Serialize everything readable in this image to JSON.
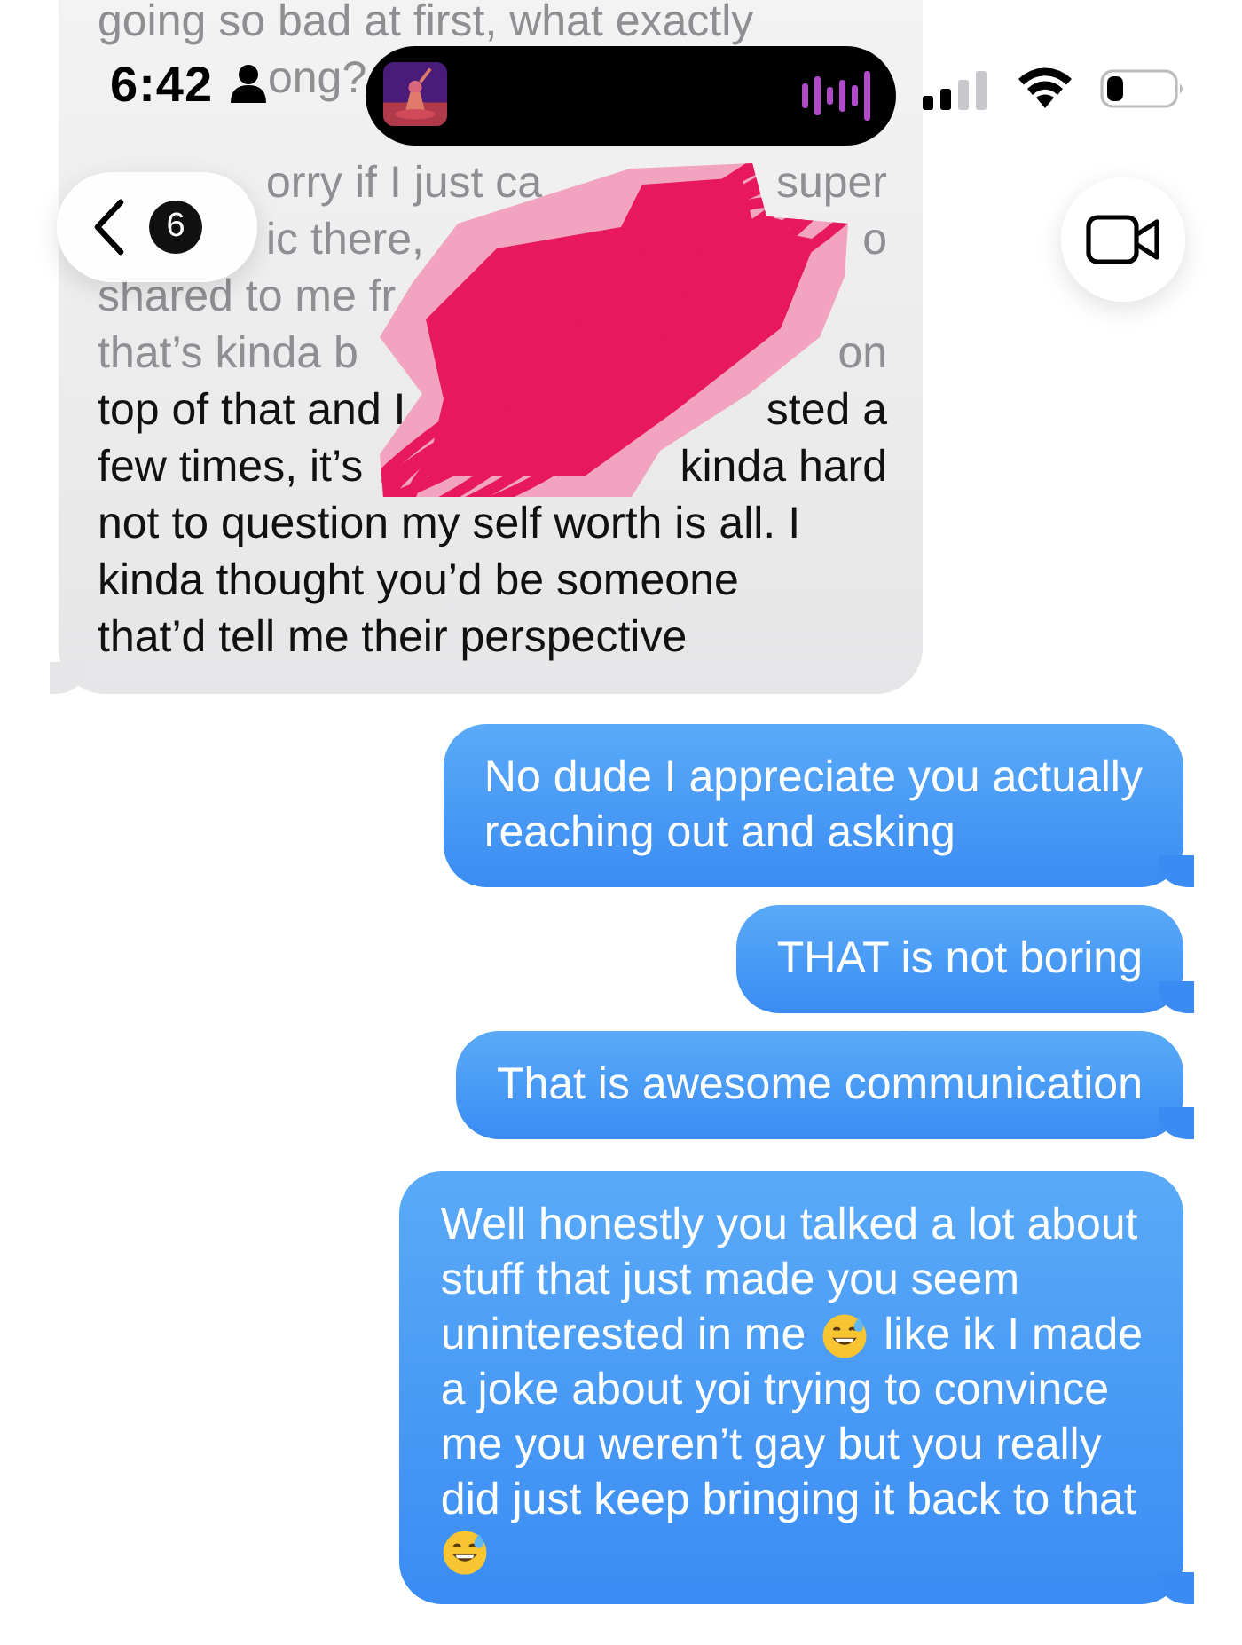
{
  "status_bar": {
    "time": "6:42"
  },
  "nav": {
    "back_count": "6"
  },
  "messages": [
    {
      "kind": "incoming",
      "lines": [
        [
          "going so bad at first, what exactly"
        ],
        [
          "ong?"
        ],
        [
          "orry if I just ca",
          "super"
        ],
        [
          "ic there,",
          "o"
        ],
        [
          "shared to me fr"
        ],
        [
          "that’s kinda b",
          "on"
        ],
        [
          "top of that and I",
          "sted a"
        ],
        [
          "few times, it’s",
          "kinda hard"
        ],
        [
          "not to question my self worth is all. I"
        ],
        [
          "kinda thought you’d be someone"
        ],
        [
          "that’d tell me their perspective"
        ]
      ]
    },
    {
      "kind": "outgoing",
      "lines": [
        [
          {
            "kind": "text",
            "text": "No dude I appreciate you actually"
          }
        ],
        [
          {
            "kind": "text",
            "text": "reaching out and asking"
          }
        ]
      ]
    },
    {
      "kind": "outgoing",
      "lines": [
        [
          {
            "kind": "text",
            "text": "THAT is not boring"
          }
        ]
      ]
    },
    {
      "kind": "outgoing",
      "lines": [
        [
          {
            "kind": "text",
            "text": "That is awesome communication"
          }
        ]
      ]
    },
    {
      "kind": "outgoing",
      "lines": [
        [
          {
            "kind": "text",
            "text": "Well honestly you talked a lot about"
          }
        ],
        [
          {
            "kind": "text",
            "text": "stuff that just made you seem"
          }
        ],
        [
          {
            "kind": "text",
            "text": "uninterested in me"
          },
          {
            "kind": "emoji"
          },
          {
            "kind": "text",
            "text": "like ik I made"
          }
        ],
        [
          {
            "kind": "text",
            "text": "a joke about yoi trying to convince"
          }
        ],
        [
          {
            "kind": "text",
            "text": "me you weren’t gay but you really"
          }
        ],
        [
          {
            "kind": "text",
            "text": "did just keep bringing it back to that"
          }
        ],
        [
          {
            "kind": "emoji"
          }
        ]
      ]
    }
  ]
}
